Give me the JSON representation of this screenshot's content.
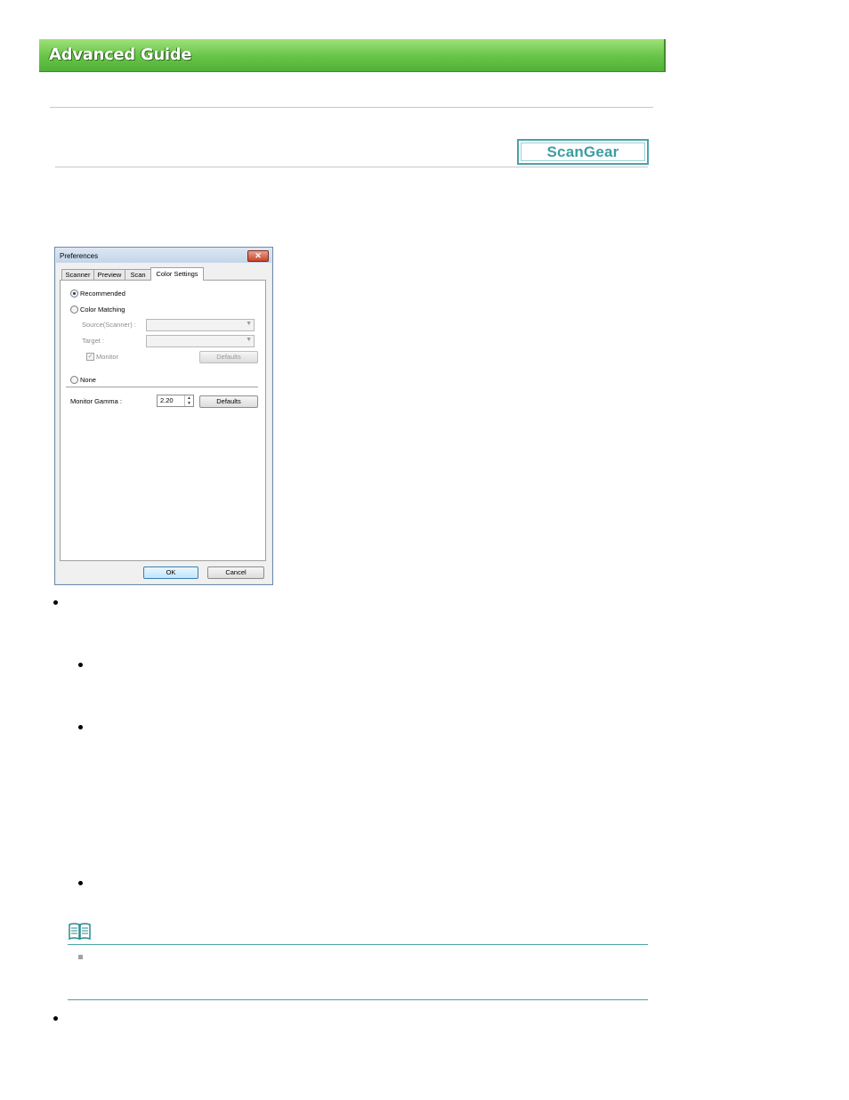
{
  "header": {
    "title": "Advanced Guide"
  },
  "badge": {
    "label": "ScanGear"
  },
  "dialog": {
    "title": "Preferences",
    "close_glyph": "✕",
    "tabs": [
      "Scanner",
      "Preview",
      "Scan",
      "Color Settings"
    ],
    "active_tab": "Color Settings",
    "options": {
      "recommended": "Recommended",
      "color_matching": "Color Matching",
      "source_label": "Source(Scanner) :",
      "target_label": "Target :",
      "monitor_label": "Monitor",
      "defaults_disabled": "Defaults",
      "none": "None"
    },
    "gamma": {
      "label": "Monitor Gamma :",
      "value": "2.20",
      "defaults": "Defaults"
    },
    "buttons": {
      "ok": "OK",
      "cancel": "Cancel"
    },
    "selected_option": "Recommended",
    "monitor_checked": true
  },
  "colors": {
    "banner": "#6bc64a",
    "badge": "#4aa3a6",
    "note_rule": "#4aa3a6"
  },
  "icons": {
    "note": "open-book-icon"
  }
}
